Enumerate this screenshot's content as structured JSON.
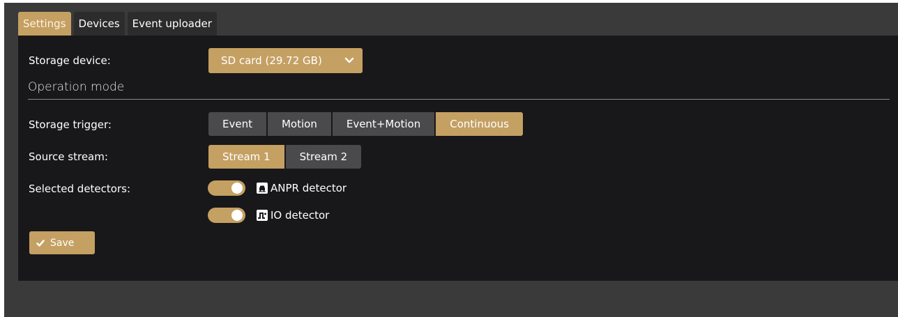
{
  "tabs": [
    {
      "label": "Settings",
      "active": true
    },
    {
      "label": "Devices",
      "active": false
    },
    {
      "label": "Event uploader",
      "active": false
    }
  ],
  "storage": {
    "label": "Storage device:",
    "selected": "SD card (29.72 GB)"
  },
  "operation_mode": {
    "title": "Operation mode"
  },
  "storage_trigger": {
    "label": "Storage trigger:",
    "options": [
      "Event",
      "Motion",
      "Event+Motion",
      "Continuous"
    ],
    "selected": "Continuous"
  },
  "source_stream": {
    "label": "Source stream:",
    "options": [
      "Stream 1",
      "Stream 2"
    ],
    "selected": "Stream 1"
  },
  "detectors": {
    "label": "Selected detectors:",
    "items": [
      {
        "label": "ANPR detector",
        "enabled": true,
        "icon": "car-icon"
      },
      {
        "label": "IO detector",
        "enabled": true,
        "icon": "signal-icon"
      }
    ]
  },
  "save": {
    "label": "Save",
    "icon": "check-icon"
  },
  "colors": {
    "accent": "#c5a063",
    "panel": "#18181a",
    "segment": "#4a4a4d",
    "background": "#3a3a3a"
  }
}
